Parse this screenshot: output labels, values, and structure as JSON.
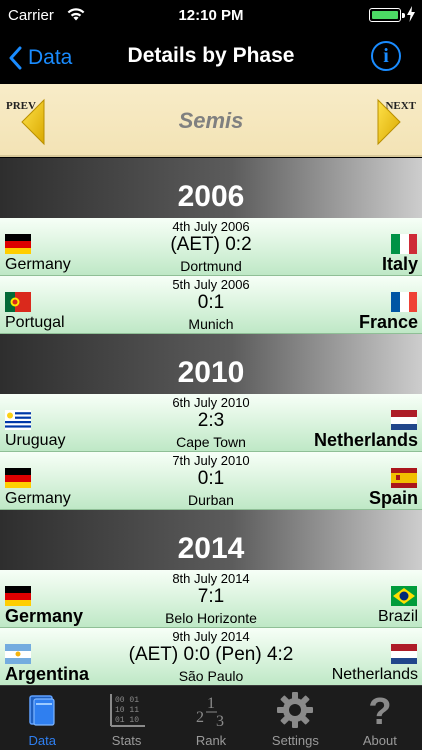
{
  "status": {
    "carrier": "Carrier",
    "time": "12:10 PM"
  },
  "nav": {
    "back_label": "Data",
    "title": "Details by Phase",
    "info_label": "i"
  },
  "phase": {
    "prev_label": "PREV",
    "next_label": "NEXT",
    "name": "Semis"
  },
  "sections": [
    {
      "year": "2006",
      "matches": [
        {
          "date": "4th July 2006",
          "score": "(AET) 0:2",
          "venue": "Dortmund",
          "home": "Germany",
          "away": "Italy",
          "winner": "away",
          "home_flag": "germany",
          "away_flag": "italy"
        },
        {
          "date": "5th July 2006",
          "score": "0:1",
          "venue": "Munich",
          "home": "Portugal",
          "away": "France",
          "winner": "away",
          "home_flag": "portugal",
          "away_flag": "france"
        }
      ]
    },
    {
      "year": "2010",
      "matches": [
        {
          "date": "6th July 2010",
          "score": "2:3",
          "venue": "Cape Town",
          "home": "Uruguay",
          "away": "Netherlands",
          "winner": "away",
          "home_flag": "uruguay",
          "away_flag": "netherlands"
        },
        {
          "date": "7th July 2010",
          "score": "0:1",
          "venue": "Durban",
          "home": "Germany",
          "away": "Spain",
          "winner": "away",
          "home_flag": "germany",
          "away_flag": "spain"
        }
      ]
    },
    {
      "year": "2014",
      "matches": [
        {
          "date": "8th July 2014",
          "score": "7:1",
          "venue": "Belo Horizonte",
          "home": "Germany",
          "away": "Brazil",
          "winner": "home",
          "home_flag": "germany",
          "away_flag": "brazil"
        },
        {
          "date": "9th July 2014",
          "score": "(AET) 0:0 (Pen) 4:2",
          "venue": "São Paulo",
          "home": "Argentina",
          "away": "Netherlands",
          "winner": "home",
          "home_flag": "argentina",
          "away_flag": "netherlands"
        }
      ]
    }
  ],
  "tabs": [
    {
      "label": "Data",
      "icon": "data-icon",
      "active": true
    },
    {
      "label": "Stats",
      "icon": "stats-icon",
      "active": false
    },
    {
      "label": "Rank",
      "icon": "rank-icon",
      "active": false
    },
    {
      "label": "Settings",
      "icon": "gear-icon",
      "active": false
    },
    {
      "label": "About",
      "icon": "question-icon",
      "active": false
    }
  ],
  "tab_icon_text": {
    "stats_digits": [
      "00 01",
      "10 11",
      "01 10"
    ],
    "rank_digits": [
      "2",
      "1",
      "3"
    ],
    "about_mark": "?"
  },
  "colors": {
    "accent": "#1a8cff",
    "active_tab": "#2f7ff0",
    "winner_row_start": "#f7fff7",
    "winner_row_end": "#bfe8c6",
    "phase_bar": "#f8ecc8"
  }
}
